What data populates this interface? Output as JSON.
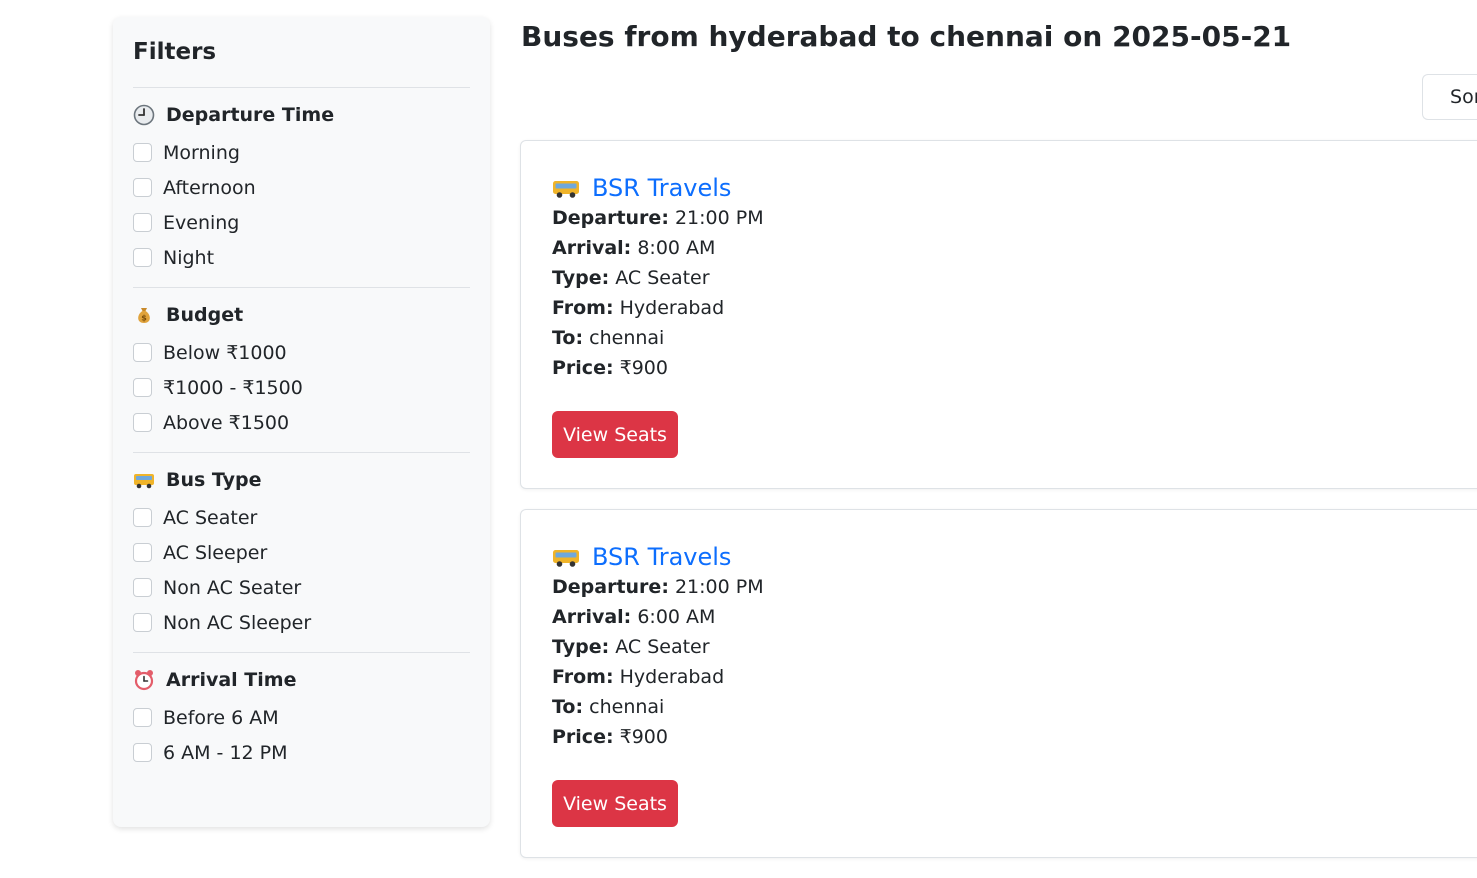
{
  "sidebar": {
    "title": "Filters",
    "sections": [
      {
        "icon": "clock-icon",
        "title": "Departure Time",
        "options": [
          "Morning",
          "Afternoon",
          "Evening",
          "Night"
        ]
      },
      {
        "icon": "money-bag-icon",
        "title": "Budget",
        "options": [
          "Below ₹1000",
          "₹1000 - ₹1500",
          "Above ₹1500"
        ]
      },
      {
        "icon": "bus-icon",
        "title": "Bus Type",
        "options": [
          "AC Seater",
          "AC Sleeper",
          "Non AC Seater",
          "Non AC Sleeper"
        ]
      },
      {
        "icon": "alarm-clock-icon",
        "title": "Arrival Time",
        "options": [
          "Before 6 AM",
          "6 AM - 12 PM"
        ]
      }
    ]
  },
  "main": {
    "title": "Buses from hyderabad to chennai on 2025-05-21",
    "sort_label": "Sort",
    "labels": {
      "departure": "Departure:",
      "arrival": "Arrival:",
      "type": "Type:",
      "from": "From:",
      "to": "To:",
      "price": "Price:"
    },
    "buses": [
      {
        "operator": "BSR Travels",
        "departure": "21:00 PM",
        "arrival": "8:00 AM",
        "type": "AC Seater",
        "from": "Hyderabad",
        "to": "chennai",
        "price": "₹900",
        "button": "View Seats"
      },
      {
        "operator": "BSR Travels",
        "departure": "21:00 PM",
        "arrival": "6:00 AM",
        "type": "AC Seater",
        "from": "Hyderabad",
        "to": "chennai",
        "price": "₹900",
        "button": "View Seats"
      }
    ]
  },
  "colors": {
    "accent": "#0d6efd",
    "danger": "#dc3545",
    "sidebar_bg": "#f8f9fa"
  }
}
